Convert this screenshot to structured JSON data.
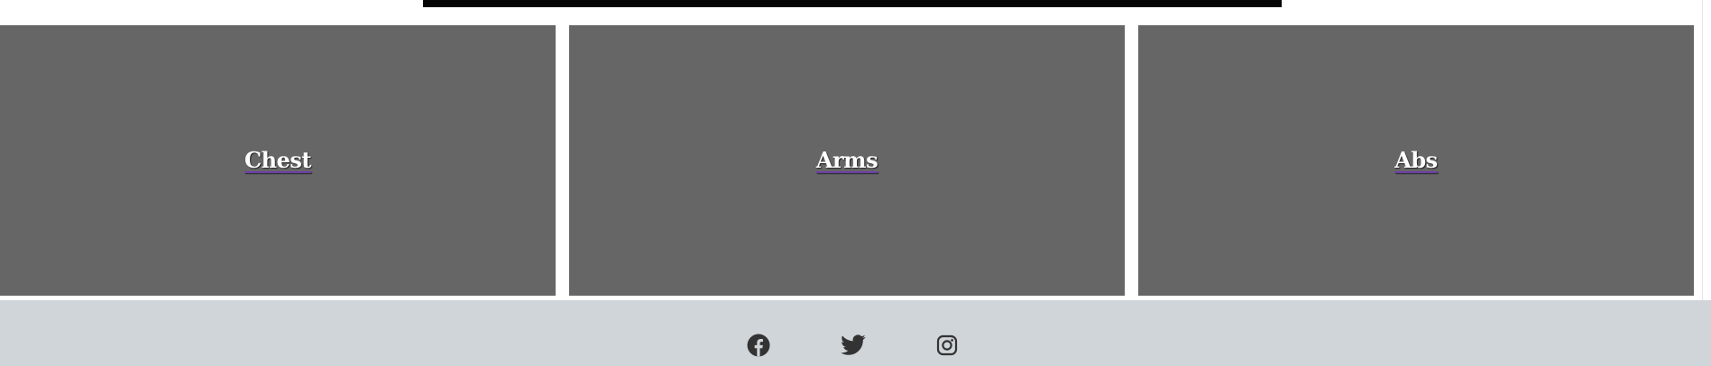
{
  "cards": [
    {
      "label": "Chest"
    },
    {
      "label": "Arms"
    },
    {
      "label": "Abs"
    }
  ],
  "footer": {
    "social_icons": [
      "facebook-icon",
      "twitter-icon",
      "instagram-icon"
    ]
  },
  "colors": {
    "card_background": "#666666",
    "footer_background": "#d0d5da",
    "top_bar": "#050505",
    "icon": "#333333",
    "link_underline": "#6c3fa8"
  }
}
